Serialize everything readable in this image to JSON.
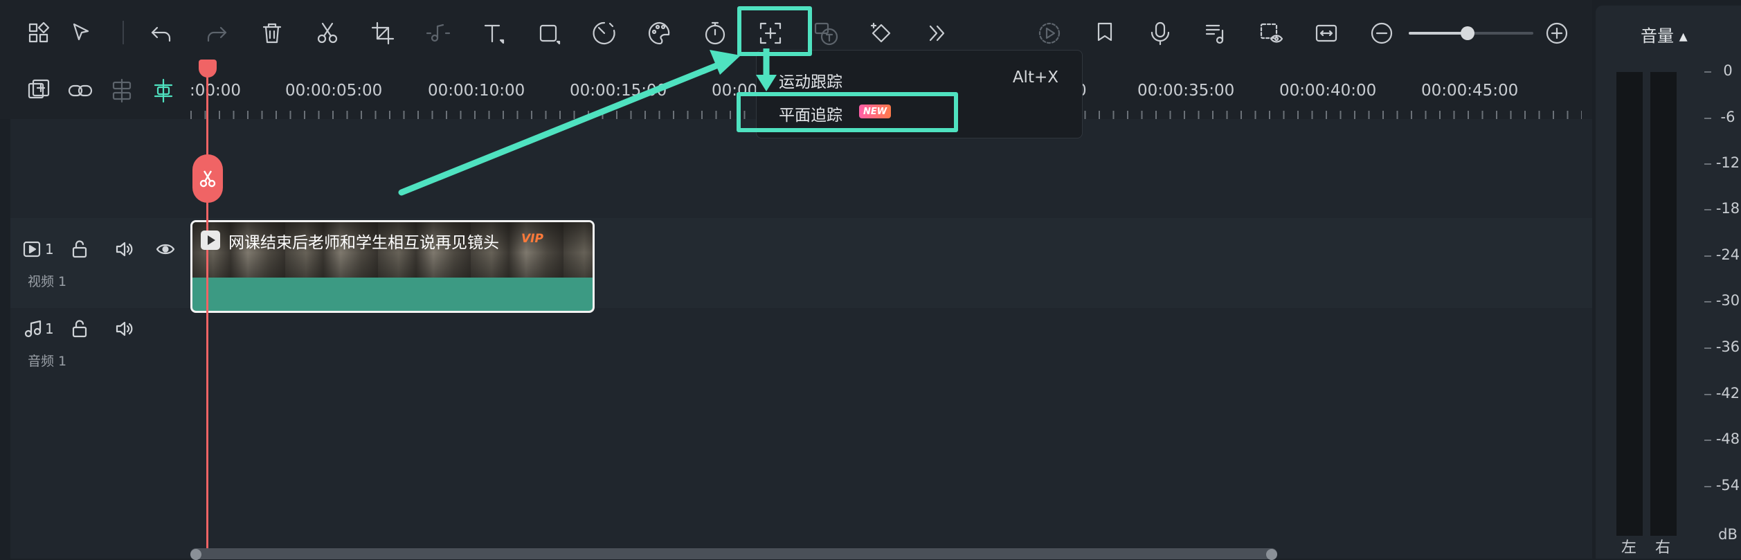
{
  "toolbar": {
    "icons": [
      "layout-icon",
      "select-pointer-icon",
      "undo-icon",
      "redo-icon",
      "delete-icon",
      "cut-icon",
      "crop-icon",
      "audio-beat-icon",
      "text-icon",
      "shape-icon",
      "speed-icon",
      "color-icon",
      "timer-icon",
      "tracking-icon",
      "ai-text-icon",
      "keyframe-icon",
      "more-icon",
      "render-preview-icon",
      "marker-icon",
      "mic-icon",
      "music-list-icon",
      "snapshot-icon",
      "fit-icon",
      "zoom-out-icon",
      "zoom-in-icon"
    ],
    "zoom_level": 0.47
  },
  "timeline_tools": [
    "add-track-icon",
    "link-icon",
    "split-track-icon",
    "magnet-icon"
  ],
  "ruler": {
    "labels": [
      ":00:00",
      "00:00:05:00",
      "00:00:10:00",
      "00:00:15:00",
      "00:00",
      "0",
      "00:00:35:00",
      "00:00:40:00",
      "00:00:45:00"
    ]
  },
  "context_menu": {
    "items": [
      {
        "label": "运动跟踪",
        "shortcut": "Alt+X"
      },
      {
        "label": "平面追踪",
        "badge": "NEW"
      }
    ]
  },
  "tracks": {
    "video": {
      "number": "1",
      "name": "视频 1"
    },
    "audio": {
      "number": "1",
      "name": "音频 1"
    }
  },
  "clip": {
    "title": "网课结束后老师和学生相互说再见镜头",
    "badge": "VIP"
  },
  "audio_panel": {
    "title": "音量 ▴",
    "db_scale": [
      "0",
      "-6",
      "-12",
      "-18",
      "-24",
      "-30",
      "-36",
      "-42",
      "-48",
      "-54",
      "dB"
    ],
    "left_label": "左",
    "right_label": "右"
  },
  "colors": {
    "highlight": "#4fe2c0",
    "playhead": "#f06465",
    "clip": "#3c9a83"
  }
}
